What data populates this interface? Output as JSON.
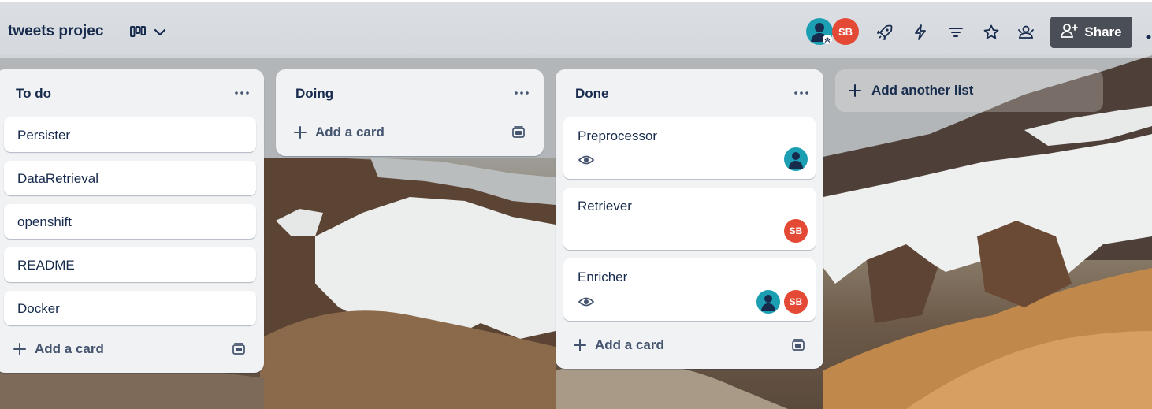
{
  "board": {
    "title": "tweets projec"
  },
  "header": {
    "share_label": "Share",
    "members": [
      {
        "initials": "",
        "color": "#1d9fb3",
        "kind": "person"
      },
      {
        "initials": "SB",
        "color": "#e34935",
        "kind": "initials"
      }
    ],
    "icons": [
      "view-icon",
      "chevron-down-icon",
      "power-ups-icon",
      "automation-icon",
      "filter-icon",
      "star-icon",
      "visibility-icon",
      "add-member-icon",
      "more-icon"
    ]
  },
  "lists": [
    {
      "title": "To do",
      "cards": [
        {
          "title": "Persister"
        },
        {
          "title": "DataRetrieval"
        },
        {
          "title": "openshift"
        },
        {
          "title": "README"
        },
        {
          "title": "Docker"
        }
      ],
      "add_card_label": "Add a card"
    },
    {
      "title": "Doing",
      "cards": [],
      "add_card_label": "Add a card"
    },
    {
      "title": "Done",
      "cards": [
        {
          "title": "Preprocessor",
          "watching": true,
          "members": [
            "person"
          ]
        },
        {
          "title": "Retriever",
          "watching": false,
          "members": [
            "SB"
          ]
        },
        {
          "title": "Enricher",
          "watching": true,
          "members": [
            "person",
            "SB"
          ]
        }
      ],
      "add_card_label": "Add a card"
    }
  ],
  "add_list_label": "Add another list",
  "colors": {
    "accent_teal": "#1d9fb3",
    "accent_red": "#e34935",
    "share_bg": "#4a4f57",
    "text": "#172b4d"
  }
}
